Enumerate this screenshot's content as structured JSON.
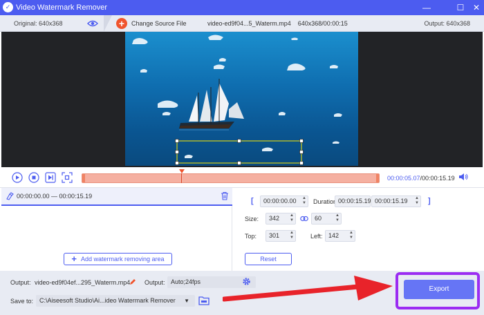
{
  "window": {
    "title": "Video Watermark Remover",
    "logo_glyph": "✓",
    "minimize": "—",
    "maximize": "☐",
    "close": "✕"
  },
  "infobar": {
    "original": "Original: 640x368",
    "change_source": "Change Source File",
    "file_info": "video-ed9f04...5_Waterm.mp4    640x368/00:00:15",
    "output": "Output: 640x368"
  },
  "playback": {
    "current_time": "00:00:05.07",
    "total_time": "/00:00:15.19"
  },
  "area_list": {
    "range": "00:00:00.00 — 00:00:15.19"
  },
  "add_area_label": "Add watermark removing area",
  "params": {
    "bracket_open": "[",
    "bracket_close": "]",
    "start": "00:00:00.00",
    "duration_label": "Duration:",
    "duration": "00:00:15.19",
    "end": "00:00:15.19",
    "size_label": "Size:",
    "width": "342",
    "height": "60",
    "top_label": "Top:",
    "top": "301",
    "left_label": "Left:",
    "left": "142",
    "reset": "Reset"
  },
  "bottom": {
    "output_label": "Output:",
    "output_file": "video-ed9f04ef...295_Waterm.mp4",
    "format_label": "Output:",
    "format": "Auto;24fps",
    "save_label": "Save to:",
    "save_path": "C:\\Aiseesoft Studio\\Ai...ideo Watermark Remover",
    "export": "Export"
  },
  "colors": {
    "accent": "#4c5cf0",
    "export": "#6675f5",
    "highlight": "#9b2cf2",
    "arrow": "#e8232a",
    "timeline": "#f5b0a1"
  }
}
